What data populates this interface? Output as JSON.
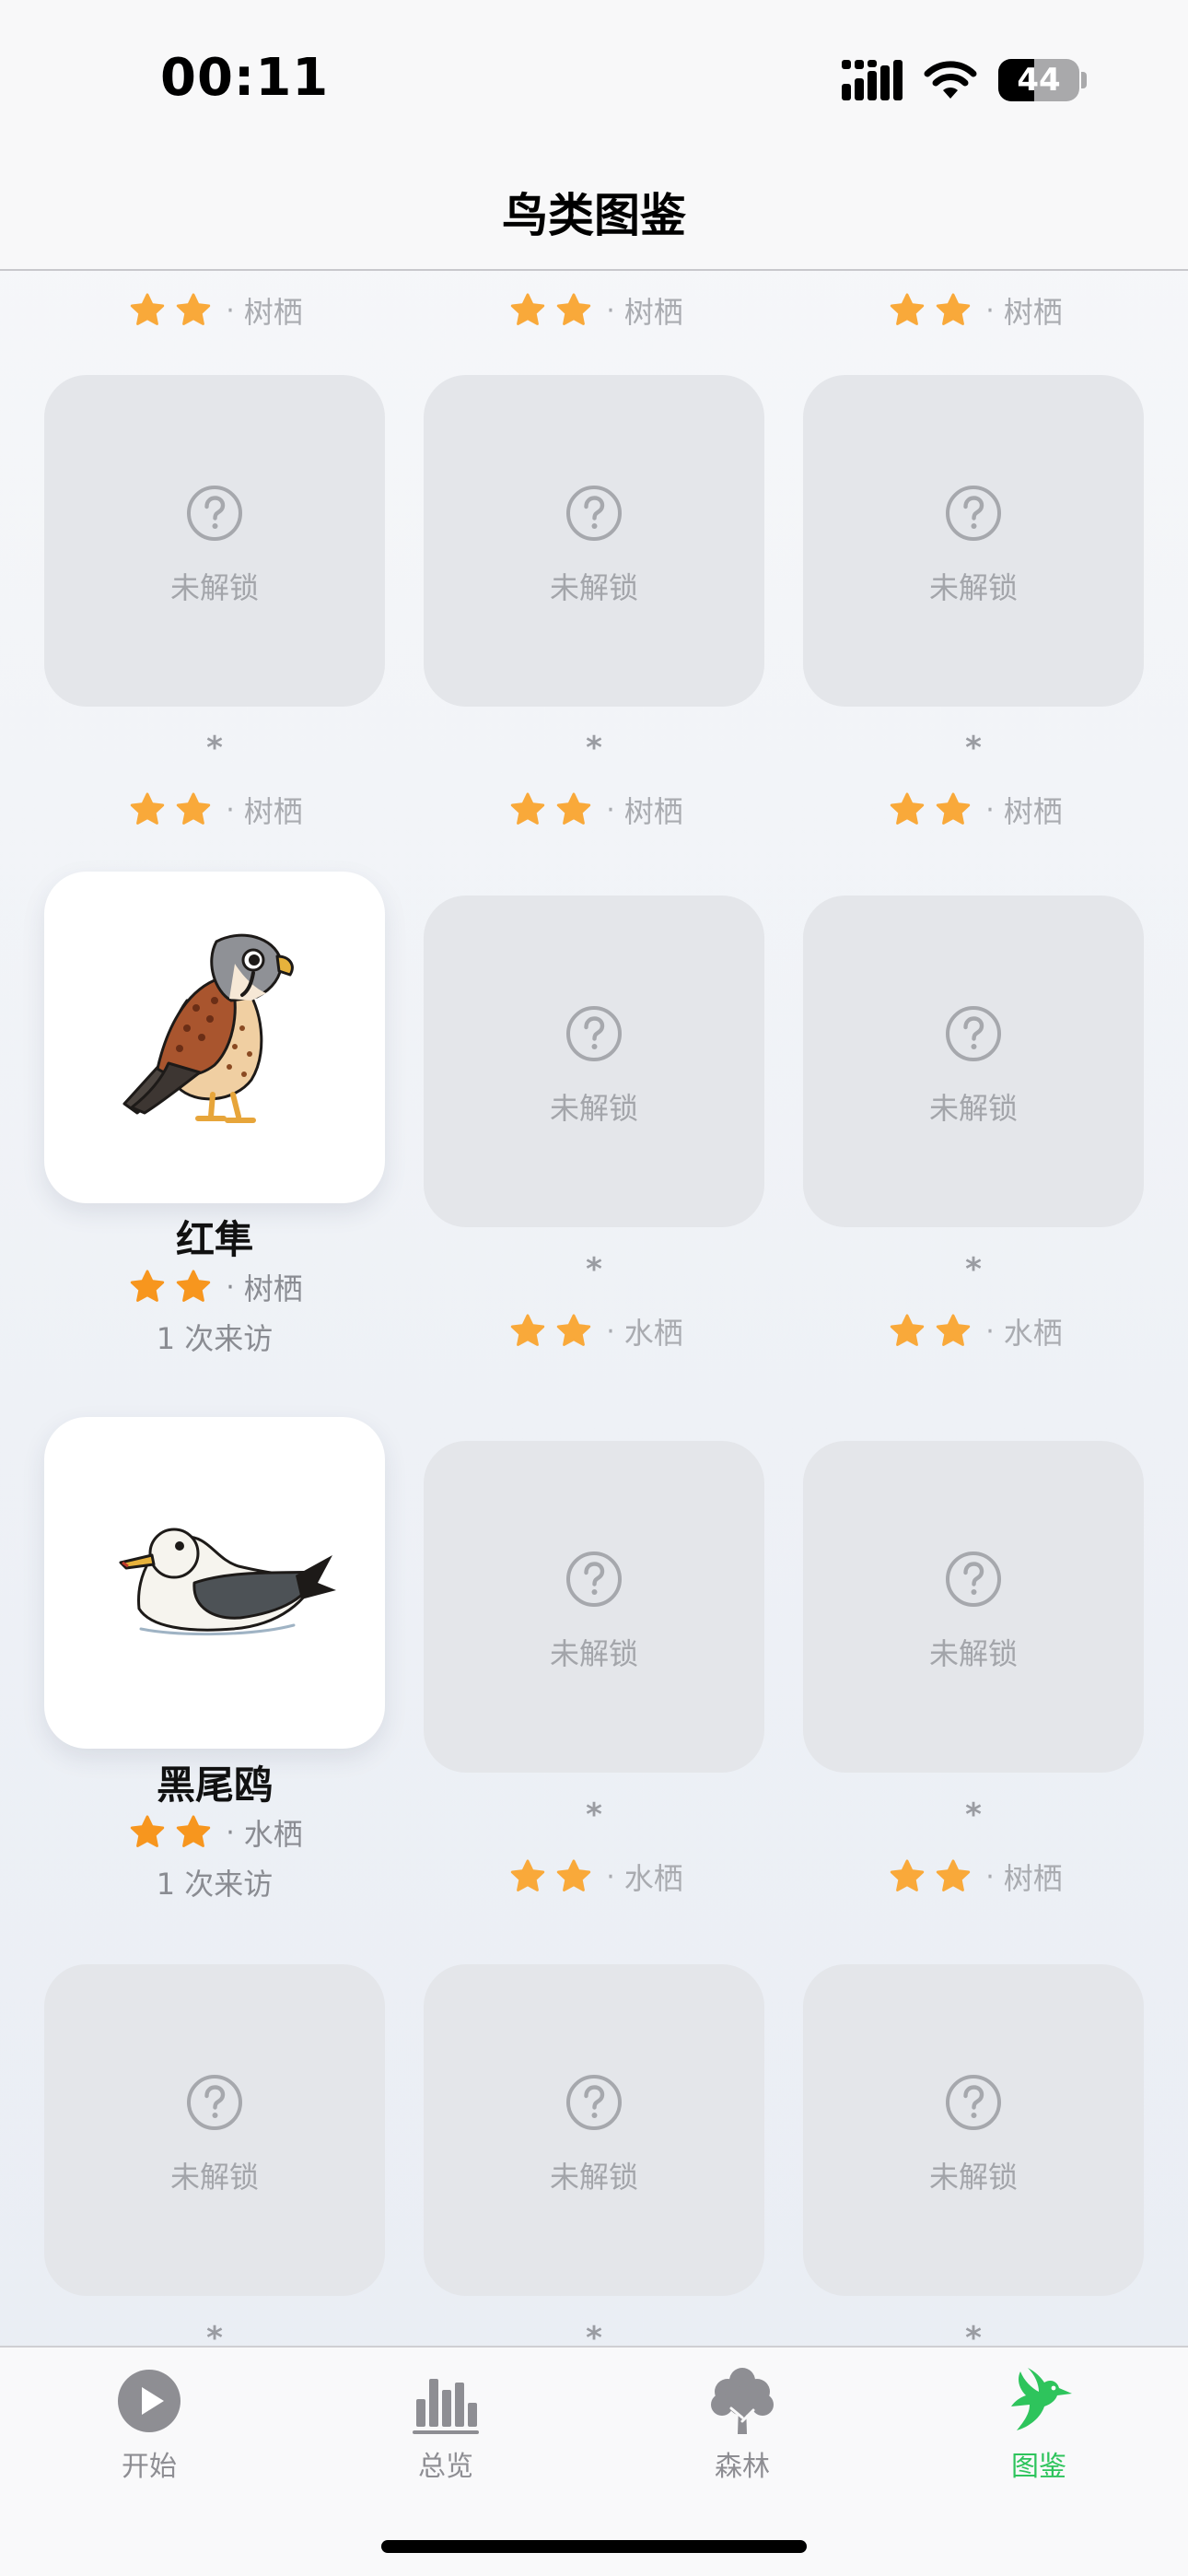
{
  "status_bar": {
    "time": "00:11",
    "battery_level": "44",
    "battery_fraction": 0.44,
    "icons": [
      "signal-icon",
      "wifi-icon",
      "battery-icon"
    ]
  },
  "nav": {
    "title": "鸟类图鉴"
  },
  "locked_label": "未解锁",
  "unknown_name": "*",
  "dot": "·",
  "colors": {
    "star": "#F9A93A",
    "star_bright": "#F7961E",
    "accent_green": "#2EC45C",
    "locked_card": "#E4E6EA",
    "tab_inactive": "#8E8E93"
  },
  "grid": {
    "top_partial_row": [
      {
        "stars": 2,
        "habitat": "树栖"
      },
      {
        "stars": 2,
        "habitat": "树栖"
      },
      {
        "stars": 2,
        "habitat": "树栖"
      }
    ],
    "row1": [
      {
        "stars": 2,
        "habitat": "树栖"
      },
      {
        "stars": 2,
        "habitat": "树栖"
      },
      {
        "stars": 2,
        "habitat": "树栖"
      }
    ],
    "row2": [
      {
        "name": "红隼",
        "stars": 2,
        "habitat": "树栖",
        "visits": "1 次来访",
        "image": "kestrel-illustration"
      },
      {
        "stars": 2,
        "habitat": "水栖"
      },
      {
        "stars": 2,
        "habitat": "水栖"
      }
    ],
    "row3": [
      {
        "name": "黑尾鸥",
        "stars": 2,
        "habitat": "水栖",
        "visits": "1 次来访",
        "image": "black-tailed-gull-illustration"
      },
      {
        "stars": 2,
        "habitat": "水栖"
      },
      {
        "stars": 2,
        "habitat": "树栖"
      }
    ]
  },
  "tabs": [
    {
      "label": "开始",
      "icon": "play-circle-icon",
      "active": false
    },
    {
      "label": "总览",
      "icon": "bar-chart-icon",
      "active": false
    },
    {
      "label": "森林",
      "icon": "tree-icon",
      "active": false
    },
    {
      "label": "图鉴",
      "icon": "hummingbird-icon",
      "active": true
    }
  ]
}
